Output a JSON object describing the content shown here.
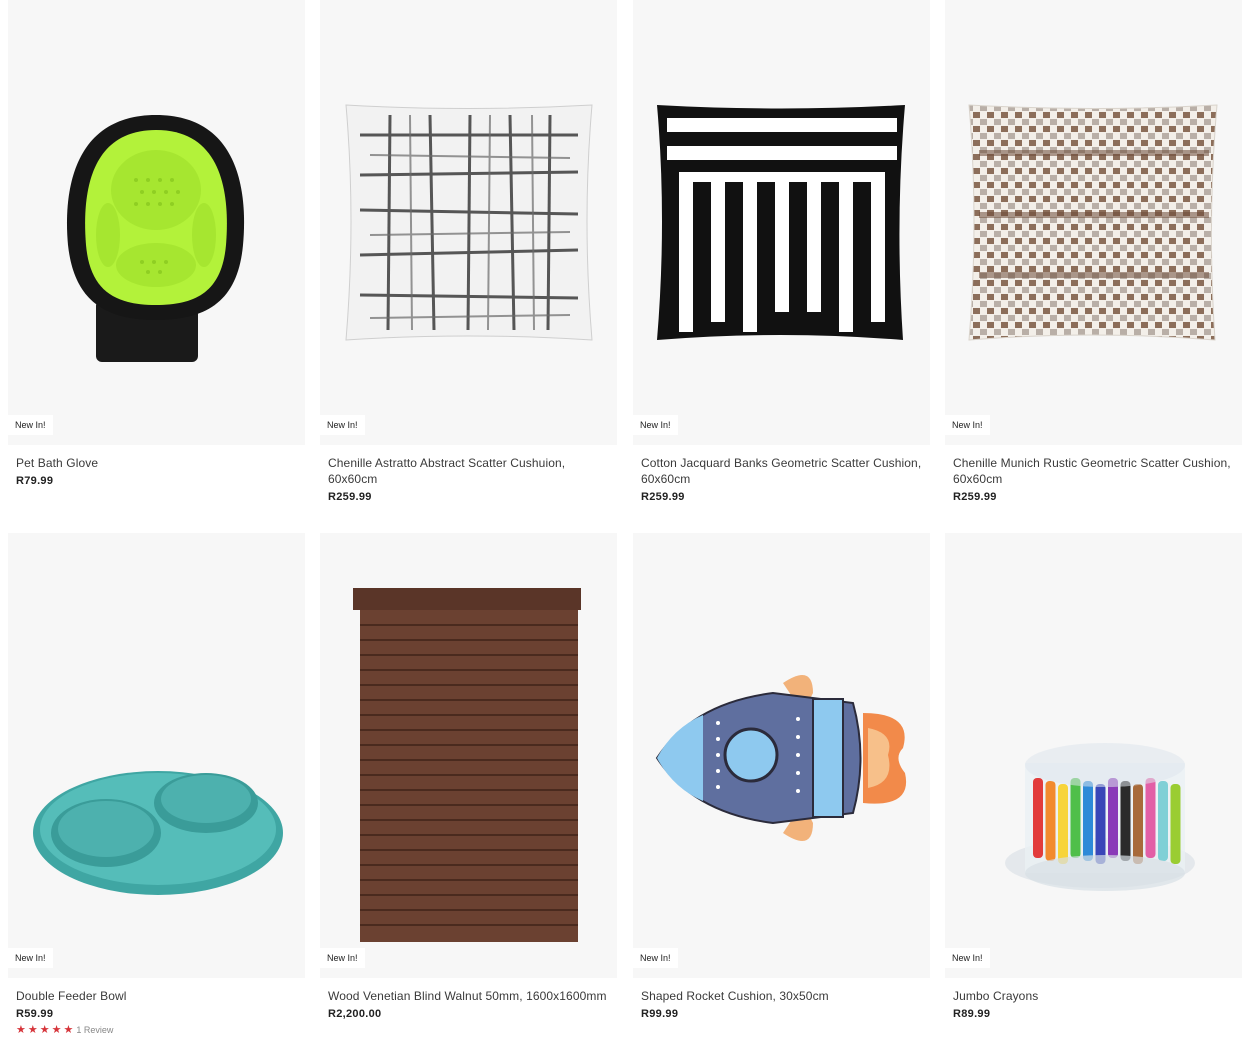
{
  "products": [
    {
      "name": "Pet Bath Glove",
      "price": "R79.99",
      "badge": "New In!",
      "icon": "pet-bath-glove-image"
    },
    {
      "name": "Chenille Astratto Abstract Scatter Cushuion, 60x60cm",
      "price": "R259.99",
      "badge": "New In!",
      "icon": "abstract-cushion-image"
    },
    {
      "name": "Cotton Jacquard Banks Geometric Scatter Cushion, 60x60cm",
      "price": "R259.99",
      "badge": "New In!",
      "icon": "geometric-cushion-image"
    },
    {
      "name": "Chenille Munich Rustic Geometric Scatter Cushion, 60x60cm",
      "price": "R259.99",
      "badge": "New In!",
      "icon": "rustic-cushion-image"
    },
    {
      "name": "Double Feeder Bowl",
      "price": "R59.99",
      "badge": "New In!",
      "icon": "feeder-bowl-image",
      "rating": 5,
      "review_text": "1 Review"
    },
    {
      "name": "Wood Venetian Blind Walnut 50mm, 1600x1600mm",
      "price": "R2,200.00",
      "badge": "New In!",
      "icon": "venetian-blind-image"
    },
    {
      "name": "Shaped Rocket Cushion, 30x50cm",
      "price": "R99.99",
      "badge": "New In!",
      "icon": "rocket-cushion-image"
    },
    {
      "name": "Jumbo Crayons",
      "price": "R89.99",
      "badge": "New In!",
      "icon": "crayons-image"
    }
  ],
  "colors": {
    "badge_bg": "#ffffff",
    "card_bg": "#f7f7f7",
    "star": "#d6343a",
    "glove_green": "#b5f23c"
  }
}
